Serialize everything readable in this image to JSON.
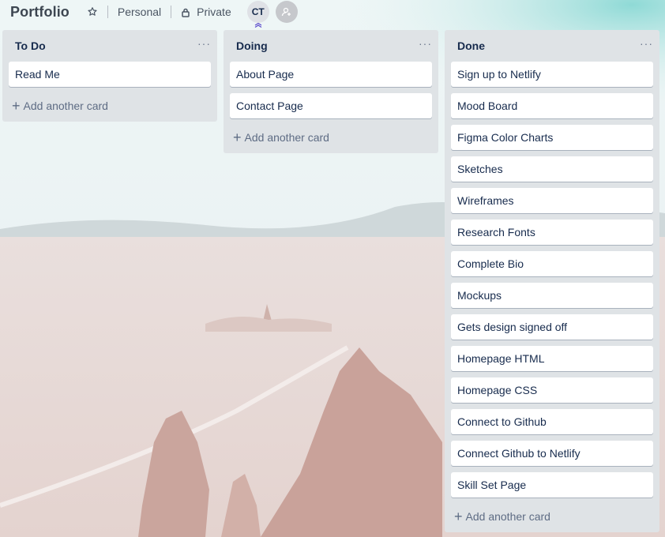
{
  "board": {
    "title": "Portfolio",
    "visibility_team": "Personal",
    "visibility_privacy": "Private",
    "member_initials": "CT"
  },
  "lists": [
    {
      "name": "To Do",
      "menu": "···",
      "cards": [
        "Read Me"
      ],
      "add_label": "Add another card"
    },
    {
      "name": "Doing",
      "menu": "···",
      "cards": [
        "About Page",
        "Contact Page"
      ],
      "add_label": "Add another card"
    },
    {
      "name": "Done",
      "menu": "···",
      "cards": [
        "Sign up to Netlify",
        "Mood Board",
        "Figma Color Charts",
        "Sketches",
        "Wireframes",
        "Research Fonts",
        "Complete Bio",
        "Mockups",
        "Gets design signed off",
        "Homepage HTML",
        "Homepage CSS",
        "Connect to Github",
        "Connect Github to Netlify",
        "Skill Set Page"
      ],
      "add_label": "Add another card"
    }
  ],
  "icons": {
    "star": "star-icon",
    "lock": "lock-icon",
    "add_member": "add-member-icon",
    "plus": "plus-icon"
  }
}
